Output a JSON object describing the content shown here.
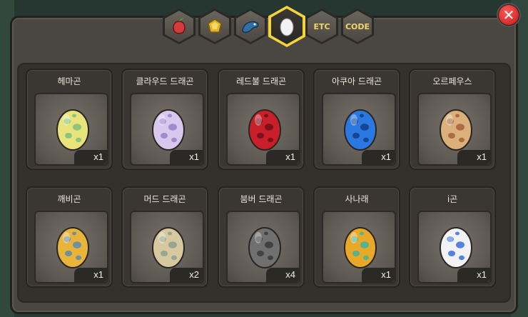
{
  "tabs": [
    {
      "id": "fruit",
      "icon": "fruit-icon",
      "active": false
    },
    {
      "id": "gem",
      "icon": "gem-icon",
      "active": false
    },
    {
      "id": "dragon",
      "icon": "dragon-icon",
      "active": false
    },
    {
      "id": "egg",
      "icon": "egg-icon",
      "active": true
    },
    {
      "id": "etc",
      "label": "ETC",
      "active": false
    },
    {
      "id": "code",
      "label": "CODE",
      "active": false
    }
  ],
  "close": {
    "icon": "close-icon"
  },
  "eggs": [
    {
      "name": "헤마곤",
      "count": "x1",
      "color": "#e8e37a",
      "spots": "#7fbf7a"
    },
    {
      "name": "클라우드 드래곤",
      "count": "x1",
      "color": "#d8c8ee",
      "spots": "#9a7ec9"
    },
    {
      "name": "레드불 드래곤",
      "count": "x1",
      "color": "#c91f2a",
      "spots": "#6e0f16"
    },
    {
      "name": "아쿠아 드래곤",
      "count": "x1",
      "color": "#2a78e0",
      "spots": "#103d86"
    },
    {
      "name": "오르페우스",
      "count": "x1",
      "color": "#dcb07a",
      "spots": "#a3603d"
    },
    {
      "name": "깨비곤",
      "count": "x1",
      "color": "#e8b43a",
      "spots": "#5a8ab0"
    },
    {
      "name": "머드 드래곤",
      "count": "x2",
      "color": "#d8c8a0",
      "spots": "#8aa090"
    },
    {
      "name": "붐버 드래곤",
      "count": "x4",
      "color": "#707070",
      "spots": "#3a3a3a"
    },
    {
      "name": "사나래",
      "count": "x1",
      "color": "#e8a828",
      "spots": "#3bb5a0"
    },
    {
      "name": "i곤",
      "count": "x1",
      "color": "#f2f2f4",
      "spots": "#3a6ed8"
    }
  ]
}
